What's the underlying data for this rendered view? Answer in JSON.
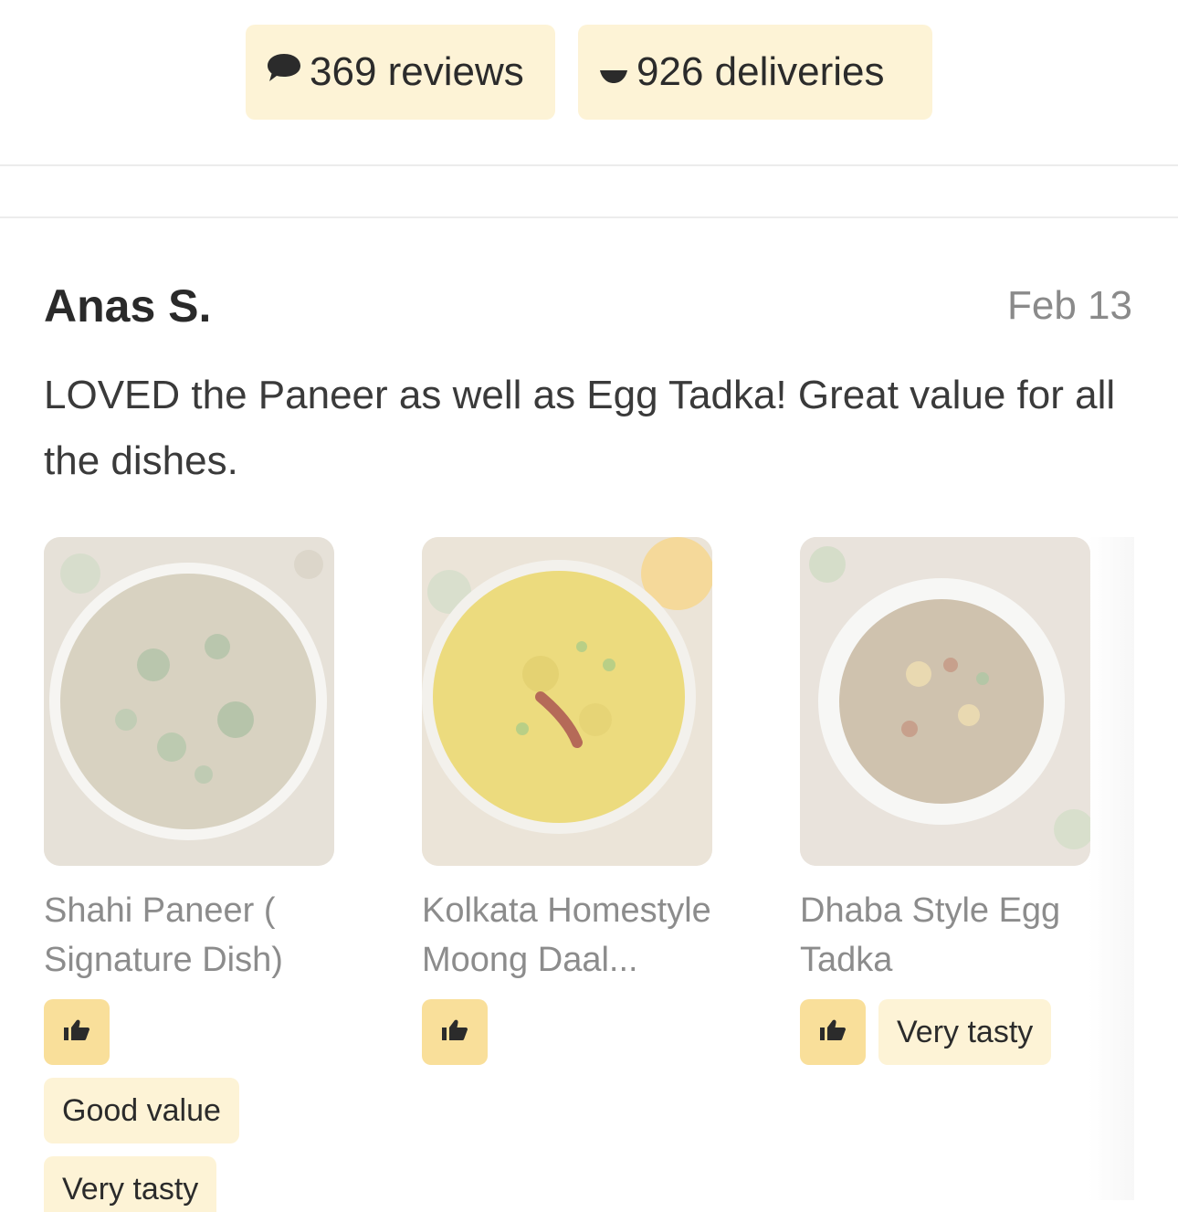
{
  "stats": {
    "reviews": "369 reviews",
    "deliveries": "926 deliveries"
  },
  "review": {
    "author": "Anas S.",
    "date": "Feb 13",
    "text": "LOVED the Paneer as well as Egg Tadka! Great value for all the dishes."
  },
  "dishes": [
    {
      "name": "Shahi Paneer ( Signature Dish)",
      "tags": [
        "Good value",
        "Very tasty"
      ]
    },
    {
      "name": "Kolkata Homestyle Moong Daal...",
      "tags": []
    },
    {
      "name": "Dhaba Style Egg Tadka",
      "tags": [
        "Very tasty"
      ]
    }
  ],
  "icons": {
    "reviews": "speech-bubble-icon",
    "deliveries": "delivery-icon",
    "thumb": "thumbs-up-icon"
  },
  "colors": {
    "chip_bg": "#fdf3d6",
    "thumb_bg": "#f9df9a",
    "text_dark": "#2a2a2a",
    "text_muted": "#8c8c8c"
  }
}
